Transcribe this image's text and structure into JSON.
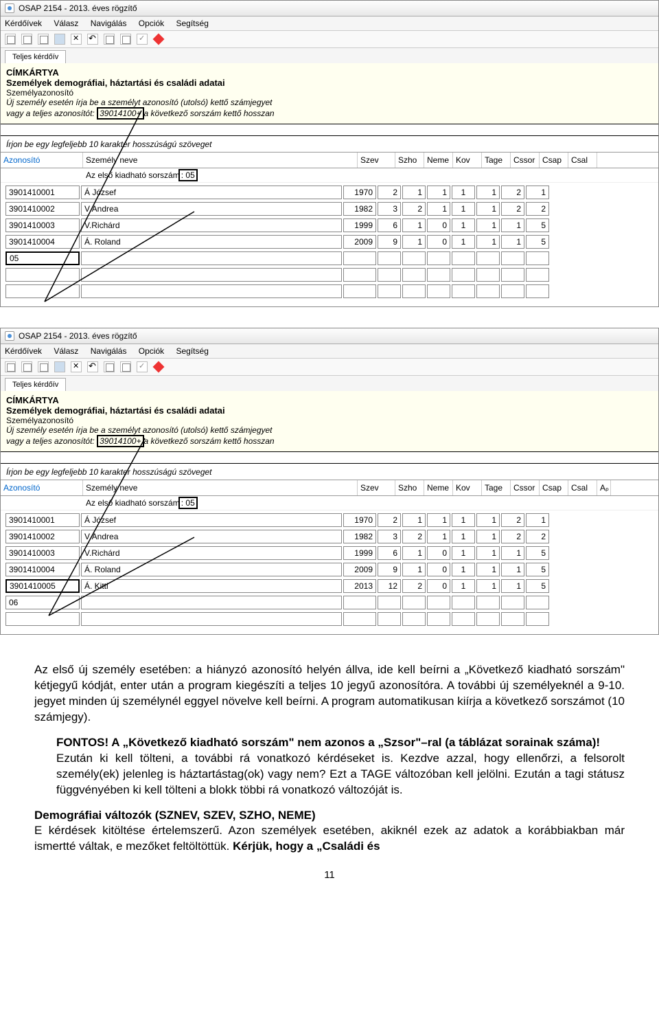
{
  "app": {
    "title": "OSAP 2154 - 2013. éves rögzítő",
    "menus": [
      "Kérdőívek",
      "Válasz",
      "Navigálás",
      "Opciók",
      "Segítség"
    ],
    "tab": "Teljes kérdőív"
  },
  "form": {
    "l1": "CÍMKÁRTYA",
    "l2": "Személyek demográfiai, háztartási és családi adatai",
    "l3": "Személyazonosító",
    "l4a": "Új személy esetén írja be a személyt azonosító (utolsó) kettő számjegyet",
    "l5a": "vagy a teljes azonosítót:",
    "l5box": "39014100+",
    "l5b": "a következő sorszám kettő hosszan",
    "l5box2": "39014100+"
  },
  "instr": "Írjon be egy legfeljebb 10 karakter hosszúságú szöveget",
  "cols": {
    "azon": "Azonosító",
    "nev": "Személy neve",
    "szev": "Szev",
    "szho": "Szho",
    "neme": "Neme",
    "kov": "Kov",
    "tage": "Tage",
    "cssor": "Cssor",
    "csap": "Csap",
    "csal": "Csal",
    "ap": "Aₚ"
  },
  "first_row_a": "Az első kiadható sorszám",
  "first_row_b": ": 05",
  "screenshot1": {
    "rows": [
      {
        "azon": "3901410001",
        "nev": "Á József",
        "szev": "1970",
        "szho": "2",
        "neme": "1",
        "kov": "1",
        "tage": "1",
        "cssor": "1",
        "csap": "2",
        "csal": "1"
      },
      {
        "azon": "3901410002",
        "nev": "V Andrea",
        "szev": "1982",
        "szho": "3",
        "neme": "2",
        "kov": "1",
        "tage": "1",
        "cssor": "1",
        "csap": "2",
        "csal": "2"
      },
      {
        "azon": "3901410003",
        "nev": "V.Richárd",
        "szev": "1999",
        "szho": "6",
        "neme": "1",
        "kov": "0",
        "tage": "1",
        "cssor": "1",
        "csap": "1",
        "csal": "5"
      },
      {
        "azon": "3901410004",
        "nev": "Á. Roland",
        "szev": "2009",
        "szho": "9",
        "neme": "1",
        "kov": "0",
        "tage": "1",
        "cssor": "1",
        "csap": "1",
        "csal": "5"
      }
    ],
    "active": "05"
  },
  "screenshot2": {
    "rows": [
      {
        "azon": "3901410001",
        "nev": "Á József",
        "szev": "1970",
        "szho": "2",
        "neme": "1",
        "kov": "1",
        "tage": "1",
        "cssor": "1",
        "csap": "2",
        "csal": "1"
      },
      {
        "azon": "3901410002",
        "nev": "V Andrea",
        "szev": "1982",
        "szho": "3",
        "neme": "2",
        "kov": "1",
        "tage": "1",
        "cssor": "1",
        "csap": "2",
        "csal": "2"
      },
      {
        "azon": "3901410003",
        "nev": "V.Richárd",
        "szev": "1999",
        "szho": "6",
        "neme": "1",
        "kov": "0",
        "tage": "1",
        "cssor": "1",
        "csap": "1",
        "csal": "5"
      },
      {
        "azon": "3901410004",
        "nev": "Á. Roland",
        "szev": "2009",
        "szho": "9",
        "neme": "1",
        "kov": "0",
        "tage": "1",
        "cssor": "1",
        "csap": "1",
        "csal": "5"
      },
      {
        "azon": "3901410005",
        "nev": "Á. Kitti",
        "szev": "2013",
        "szho": "12",
        "neme": "2",
        "kov": "0",
        "tage": "1",
        "cssor": "1",
        "csap": "1",
        "csal": "5"
      }
    ],
    "active_row_azon": "3901410005",
    "next": "06"
  },
  "para1": "Az első új személy esetében: a hiányzó azonosító helyén állva, ide kell beírni a „Következő kiadható sorszám\" kétjegyű kódját, enter után a program kiegészíti a teljes 10 jegyű azonosítóra. A további új személyeknél a 9-10. jegyet minden új személynél eggyel növelve kell beírni. A program automatikusan kiírja a következő sorszámot (10 számjegy).",
  "para2a": "FONTOS! A „Következő kiadható sorszám\" nem azonos a „Szsor\"–ral (a táblázat sorainak száma)!",
  "para2b": "Ezután ki kell tölteni, a további rá vonatkozó kérdéseket is. Kezdve azzal, hogy ellenőrzi, a felsorolt személy(ek) jelenleg is háztartástag(ok) vagy nem? Ezt a TAGE változóban kell jelölni. Ezután a tagi státusz függvényében ki kell tölteni a blokk többi rá vonatkozó változóját is.",
  "para3h": "Demográfiai változók (SZNEV, SZEV, SZHO, NEME)",
  "para3": "E kérdések kitöltése értelemszerű. Azon személyek esetében, akiknél ezek az adatok a korábbiakban már ismertté váltak, e mezőket feltöltöttük. ",
  "para3b": "Kérjük, hogy a „Családi és",
  "page": "11"
}
